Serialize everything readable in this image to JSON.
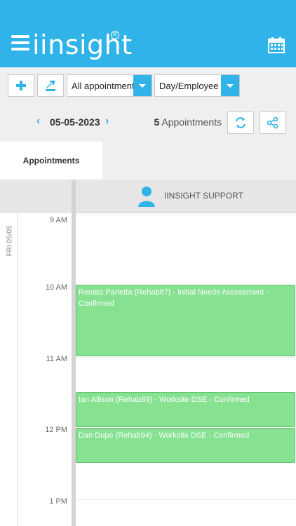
{
  "app": {
    "logo_text": "iinsight",
    "logo_reg": "R"
  },
  "icons": {
    "menu": "hamburger-icon",
    "calendar": "calendar-icon",
    "add": "plus-icon",
    "export": "export-icon",
    "refresh": "refresh-icon",
    "share": "share-icon",
    "person": "person-icon"
  },
  "toolbar": {
    "filter_select": "All appointment",
    "view_select": "Day/Employee"
  },
  "datebar": {
    "date": "05-05-2023",
    "count_number": "5",
    "count_label": "Appointments"
  },
  "tabs": [
    {
      "label": "Appointments",
      "active": true
    }
  ],
  "column": {
    "employee": "IINSIGHT SUPPORT"
  },
  "calendar": {
    "day_label": "FRI 05/05",
    "times": [
      "9 AM",
      "10 AM",
      "11 AM",
      "12 PM",
      "1 PM"
    ],
    "appointments": [
      {
        "text": "Renato Parletta (Rehab87) - Initial Needs Assessment - Confirmed"
      },
      {
        "text": "Ian Allison (Rehab89) - Worksite DSE - Confirmed"
      },
      {
        "text": "Dan Dupe (Rehab94) - Worksite DSE - Confirmed"
      }
    ]
  },
  "colors": {
    "accent": "#2fb3e8",
    "appointment": "#86e191"
  }
}
